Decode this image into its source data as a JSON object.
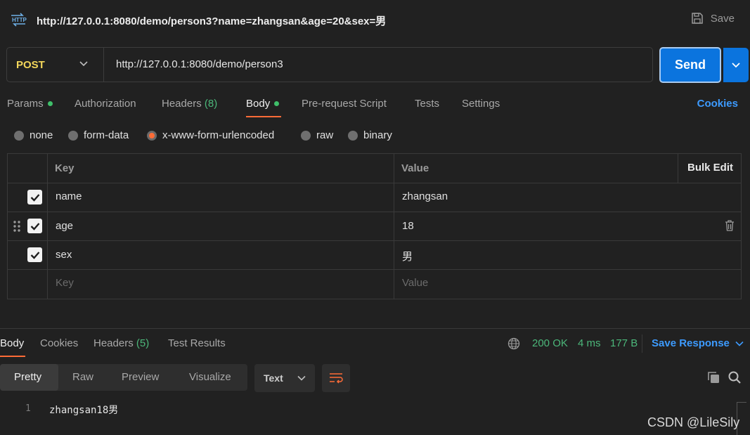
{
  "window": {
    "title": "http://127.0.0.1:8080/demo/person3?name=zhangsan&age=20&sex=男",
    "save_label": "Save"
  },
  "request": {
    "method": "POST",
    "method_color": "#f2d65b",
    "url": "http://127.0.0.1:8080/demo/person3",
    "send_label": "Send"
  },
  "tabs": [
    {
      "label": "Params",
      "dot": true
    },
    {
      "label": "Authorization"
    },
    {
      "label": "Headers",
      "count": "(8)"
    },
    {
      "label": "Body",
      "dot": true,
      "active": true
    },
    {
      "label": "Pre-request Script"
    },
    {
      "label": "Tests"
    },
    {
      "label": "Settings"
    }
  ],
  "cookies_label": "Cookies",
  "body_types": [
    {
      "label": "none",
      "selected": false
    },
    {
      "label": "form-data",
      "selected": false
    },
    {
      "label": "x-www-form-urlencoded",
      "selected": true
    },
    {
      "label": "raw",
      "selected": false
    },
    {
      "label": "binary",
      "selected": false
    }
  ],
  "params_table": {
    "key_header": "Key",
    "value_header": "Value",
    "bulk_edit_label": "Bulk Edit",
    "rows": [
      {
        "checked": true,
        "key": "name",
        "value": "zhangsan"
      },
      {
        "checked": true,
        "key": "age",
        "value": "18"
      },
      {
        "checked": true,
        "key": "sex",
        "value": "男"
      }
    ],
    "key_placeholder": "Key",
    "value_placeholder": "Value"
  },
  "response": {
    "tabs": [
      {
        "label": "Body",
        "active": true
      },
      {
        "label": "Cookies"
      },
      {
        "label": "Headers",
        "count": "(5)"
      },
      {
        "label": "Test Results"
      }
    ],
    "status": "200 OK",
    "time": "4 ms",
    "size": "177 B",
    "save_response_label": "Save Response",
    "view_modes": [
      "Pretty",
      "Raw",
      "Preview",
      "Visualize"
    ],
    "format": "Text",
    "lines": [
      {
        "no": "1",
        "text": "zhangsan18男"
      }
    ]
  },
  "accent_color": "#ff6c37",
  "link_color": "#3d9bff",
  "success_color": "#4cb77a",
  "watermark": "CSDN @LileSily"
}
